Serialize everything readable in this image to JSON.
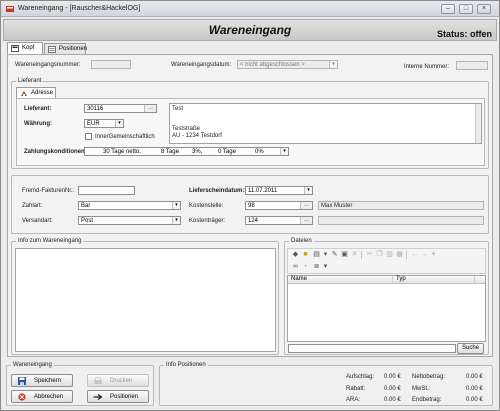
{
  "window": {
    "title": "Wareneingang - [Rauscher&HackelOG]"
  },
  "header": {
    "title": "Wareneingang",
    "status": "Status: offen"
  },
  "tabs": [
    "Kopf",
    "Positionen"
  ],
  "top": {
    "wareneingangsnummer_label": "Wareneingangsnummer:",
    "wareneingangsnummer_value": "",
    "datum_label": "Wareneingangsdatum:",
    "datum_value": "< nicht abgeschlossen >",
    "interne_label": "Interne Nummer:",
    "interne_value": ""
  },
  "lieferant": {
    "group_title": "Lieferant",
    "subtab": "Adresse",
    "lieferant_label": "Lieferant:",
    "lieferant_value": "30116",
    "waehrung_label": "Währung:",
    "waehrung_value": "EUR",
    "innergem_label": "InnerGemeinschaftlich",
    "zahlungskond_label": "Zahlungskonditionen:",
    "zk_days": "30 Tage netto,",
    "zk_days2": "8 Tage",
    "zk_pct": "3%,",
    "zk_days3": "0 Tage",
    "zk_pct2": "0%",
    "address_name": "Test",
    "address_street": "Teststraße",
    "address_city": "AU - 1234 Testdorf"
  },
  "details": {
    "fremd_label": "Fremd-FakturenNr.:",
    "fremd_value": "",
    "lieferschein_label": "Lieferscheindatum:",
    "lieferschein_value": "11.07.2011",
    "zahlart_label": "Zahlart:",
    "zahlart_value": "Bar",
    "kostenstelle_label": "Kostenstelle:",
    "kostenstelle_value": "98",
    "kostenstelle_name": "Max Muster",
    "versandart_label": "Versandart:",
    "versandart_value": "Post",
    "kostentraeger_label": "Kostenträger:",
    "kostentraeger_value": "124"
  },
  "info": {
    "title": "Info zum Wareneingang"
  },
  "dateien": {
    "title": "Dateien",
    "columns": [
      "Name",
      "Typ"
    ],
    "search_button": "Suche"
  },
  "footer": {
    "we_group": "Wareneingang",
    "speichern": "Speichern",
    "drucken": "Drucken",
    "abbrechen": "Abbrechen",
    "positionen": "Positionen",
    "info_group": "Info Positionen",
    "aufschlag_label": "Aufschlag:",
    "aufschlag_value": "0.00 €",
    "rabatt_label": "Rabatt:",
    "rabatt_value": "0.00 €",
    "ara_label": "ARA:",
    "ara_value": "0.00 €",
    "netto_label": "Nettobetrag:",
    "netto_value": "0.00 €",
    "mwst_label": "MwSt.:",
    "mwst_value": "0.00 €",
    "end_label": "Endbetrag:",
    "end_value": "0.00 €"
  },
  "colors": {
    "accent_blue": "#3a6fc4",
    "save_icon": "#2e4fa8",
    "cancel_icon": "#d23a2a"
  },
  "icons": [
    "app-icon",
    "minimize-icon",
    "maximize-icon",
    "close-icon",
    "head-icon",
    "positions-icon",
    "address-icon",
    "save-icon",
    "print-icon",
    "cancel-icon",
    "arrow-icon",
    "search-icon"
  ]
}
